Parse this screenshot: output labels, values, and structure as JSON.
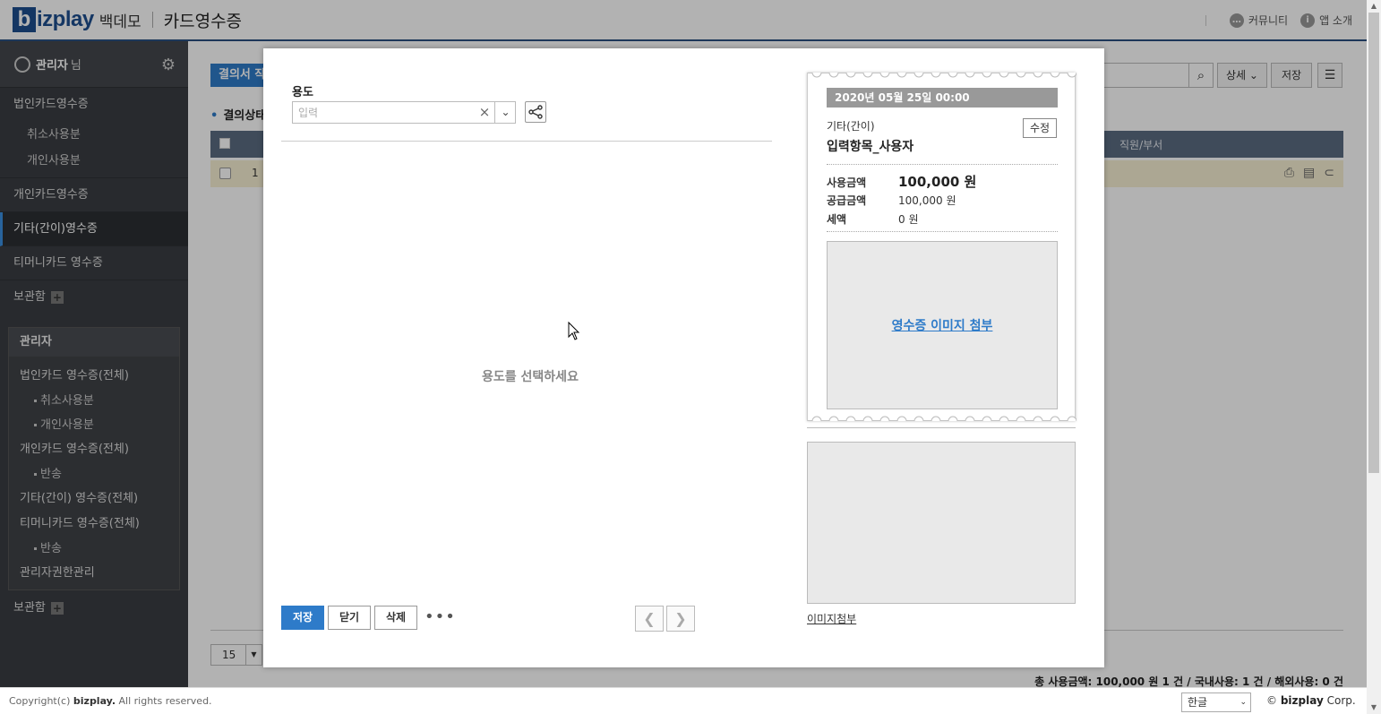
{
  "header": {
    "logo_b": "b",
    "logo_text": "izplay",
    "company": "백데모",
    "title": "카드영수증",
    "links": [
      {
        "icon": "chat-icon",
        "label": "커뮤니티"
      },
      {
        "icon": "info-icon",
        "label": "앱 소개"
      }
    ]
  },
  "sidebar": {
    "user_name": "관리자",
    "user_suffix": "님",
    "items": [
      {
        "label": "법인카드영수증",
        "subs": [
          "취소사용분",
          "개인사용분"
        ]
      },
      {
        "label": "개인카드영수증"
      },
      {
        "label": "기타(간이)영수증",
        "active": true
      },
      {
        "label": "티머니카드 영수증"
      },
      {
        "label": "보관함"
      }
    ],
    "admin": {
      "title": "관리자",
      "items": [
        {
          "label": "법인카드 영수증(전체)",
          "subs": [
            "취소사용분",
            "개인사용분"
          ]
        },
        {
          "label": "개인카드 영수증(전체)",
          "subs": [
            "반송"
          ]
        },
        {
          "label": "기타(간이) 영수증(전체)"
        },
        {
          "label": "티머니카드 영수증(전체)",
          "subs": [
            "반송"
          ]
        },
        {
          "label": "관리자권한관리"
        }
      ]
    },
    "bottom": "보관함"
  },
  "main": {
    "blue_button": "결의서 작",
    "detail_label": "상세",
    "save_label": "저장",
    "section_title": "결의상태",
    "table_header_dept": "직원/부서",
    "row_number": "1",
    "page_size": "15",
    "summary": "총 사용금액: 100,000 원 1 건 / 국내사용: 1 건 / 해외사용: 0 건"
  },
  "modal": {
    "field_label": "용도",
    "field_placeholder": "입력",
    "field_value": "",
    "empty_message": "용도를 선택하세요",
    "buttons": {
      "save": "저장",
      "close": "닫기",
      "delete": "삭제",
      "more": "•••"
    },
    "receipt": {
      "date": "2020년 05월 25일 00:00",
      "type": "기타(간이)",
      "name": "입력항목_사용자",
      "edit": "수정",
      "amounts": [
        {
          "label": "사용금액",
          "value": "100,000 원"
        },
        {
          "label": "공급금액",
          "value": "100,000 원"
        },
        {
          "label": "세액",
          "value": "0 원"
        }
      ],
      "attach_link": "영수증 이미지 첨부"
    },
    "image_attach": "이미지첨부"
  },
  "footer": {
    "copyright_prefix": "Copyright(c)",
    "copyright_brand": "bizplay.",
    "copyright_suffix": "All rights reserved.",
    "language": "한글",
    "corp_symbol": "©",
    "corp_brand": "bizplay",
    "corp_suffix": "Corp."
  },
  "colors": {
    "accent": "#2e7bc9",
    "sidebar": "#3a3d42",
    "brand": "#1d4e8f"
  }
}
